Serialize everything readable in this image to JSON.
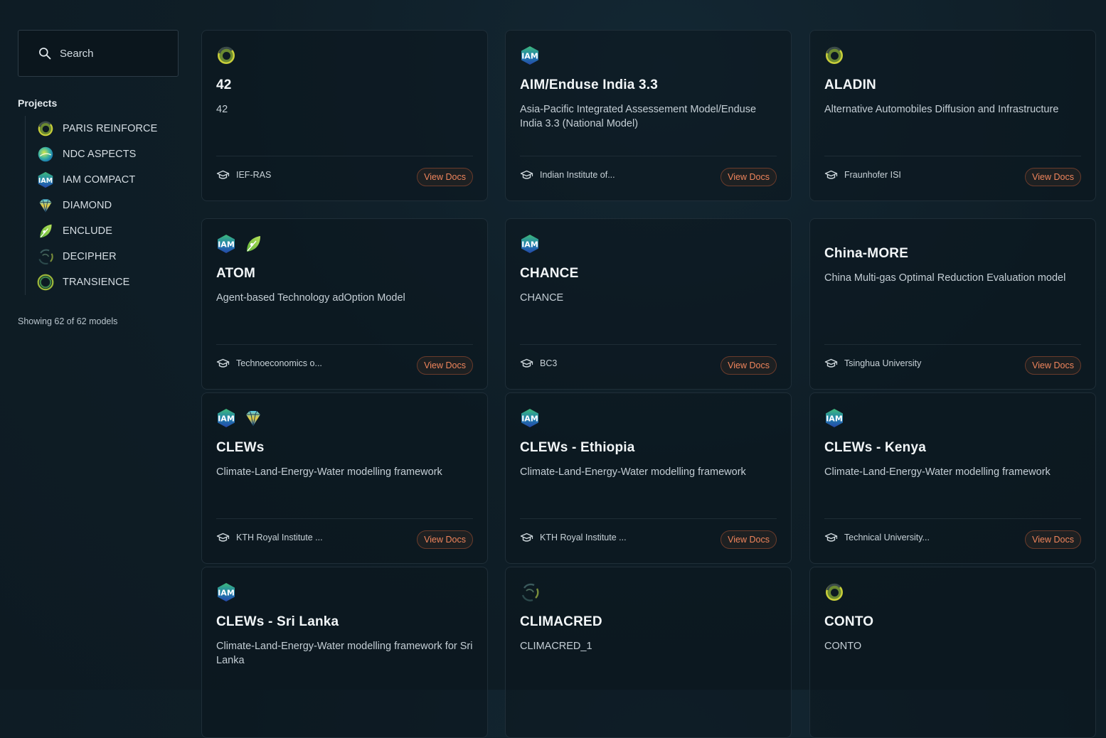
{
  "search": {
    "placeholder": "Search"
  },
  "sidebar": {
    "heading": "Projects",
    "projects": [
      {
        "label": "PARIS REINFORCE",
        "icon": "paris-reinforce-logo-icon"
      },
      {
        "label": "NDC ASPECTS",
        "icon": "ndc-aspects-logo-icon"
      },
      {
        "label": "IAM COMPACT",
        "icon": "iam-compact-logo-icon"
      },
      {
        "label": "DIAMOND",
        "icon": "diamond-logo-icon"
      },
      {
        "label": "ENCLUDE",
        "icon": "enclude-leaf-icon"
      },
      {
        "label": "DECIPHER",
        "icon": "decipher-logo-icon"
      },
      {
        "label": "TRANSIENCE",
        "icon": "transience-logo-icon"
      }
    ],
    "showing": "Showing 62 of 62 models"
  },
  "cards": [
    {
      "title": "42",
      "desc": "42",
      "institution": "IEF-RAS",
      "docs": "View Docs",
      "icons": [
        "paris"
      ]
    },
    {
      "title": "AIM/Enduse India 3.3",
      "desc": "Asia-Pacific Integrated Assessement Model/Enduse India 3.3 (National Model)",
      "institution": "Indian Institute of...",
      "docs": "View Docs",
      "icons": [
        "iam"
      ]
    },
    {
      "title": "ALADIN",
      "desc": "Alternative Automobiles Diffusion and Infrastructure",
      "institution": "Fraunhofer ISI",
      "docs": "View Docs",
      "icons": [
        "paris"
      ]
    },
    {
      "title": "ATOM",
      "desc": "Agent-based Technology adOption Model",
      "institution": "Technoeconomics o...",
      "docs": "View Docs",
      "icons": [
        "iam",
        "leaf"
      ]
    },
    {
      "title": "CHANCE",
      "desc": "CHANCE",
      "institution": "BC3",
      "docs": "View Docs",
      "icons": [
        "iam"
      ]
    },
    {
      "title": "China-MORE",
      "desc": "China Multi-gas Optimal Reduction Evaluation model",
      "institution": "Tsinghua University",
      "docs": "View Docs",
      "icons": []
    },
    {
      "title": "CLEWs",
      "desc": "Climate-Land-Energy-Water modelling framework",
      "institution": "KTH Royal Institute ...",
      "docs": "View Docs",
      "icons": [
        "iam",
        "diamond"
      ]
    },
    {
      "title": "CLEWs - Ethiopia",
      "desc": "Climate-Land-Energy-Water modelling framework",
      "institution": "KTH Royal Institute ...",
      "docs": "View Docs",
      "icons": [
        "iam"
      ]
    },
    {
      "title": "CLEWs - Kenya",
      "desc": "Climate-Land-Energy-Water modelling framework",
      "institution": "Technical University...",
      "docs": "View Docs",
      "icons": [
        "iam"
      ]
    },
    {
      "title": "CLEWs - Sri Lanka",
      "desc": "Climate-Land-Energy-Water modelling framework for Sri Lanka",
      "institution": "",
      "docs": "",
      "icons": [
        "iam"
      ]
    },
    {
      "title": "CLIMACRED",
      "desc": "CLIMACRED_1",
      "institution": "",
      "docs": "",
      "icons": [
        "decipher"
      ]
    },
    {
      "title": "CONTO",
      "desc": "CONTO",
      "institution": "",
      "docs": "",
      "icons": [
        "paris"
      ]
    }
  ],
  "colors": {
    "accent": "#f0855c",
    "background": "#0f1d26",
    "card_border": "#1f2e38"
  }
}
